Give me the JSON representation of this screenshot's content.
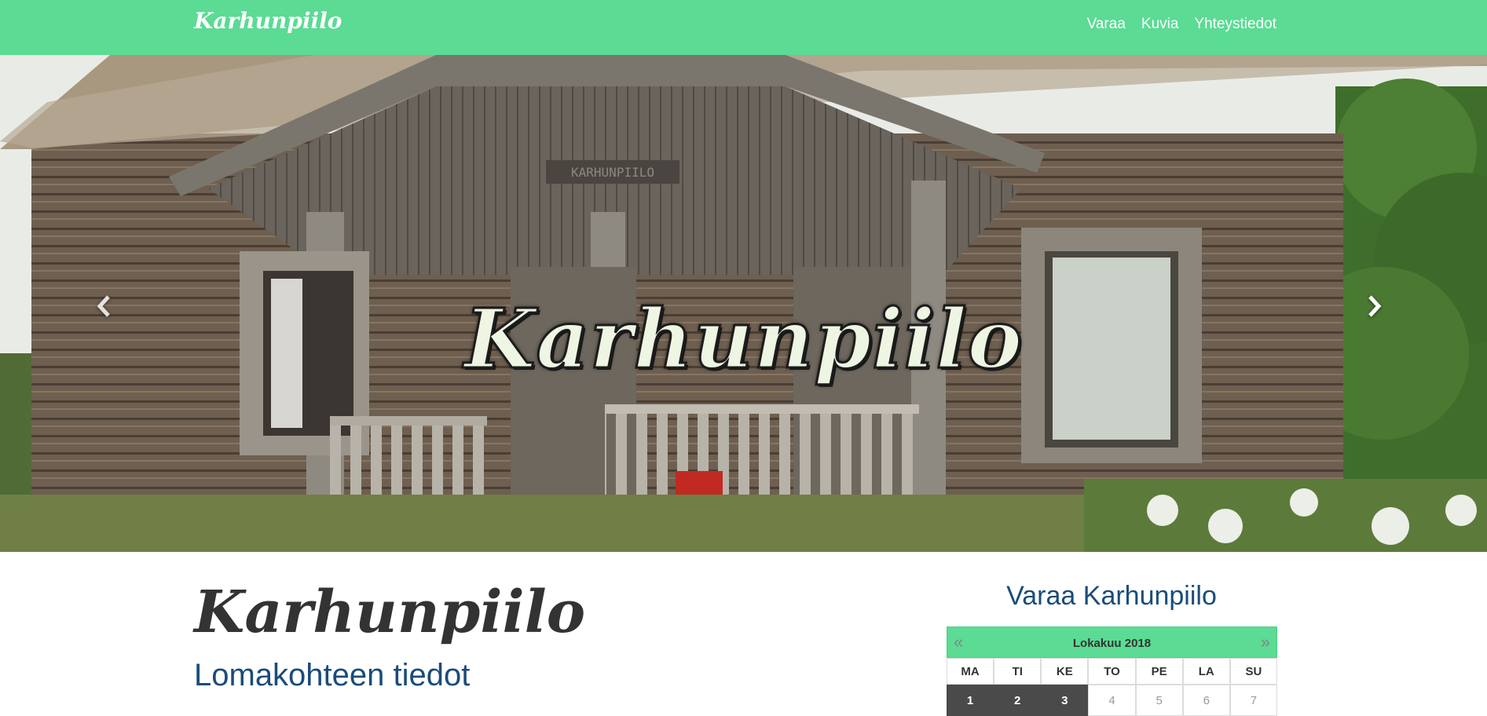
{
  "navbar": {
    "brand": "Karhunpiilo",
    "links": [
      "Varaa",
      "Kuvia",
      "Yhteystiedot"
    ]
  },
  "hero": {
    "title": "Karhunpiilo",
    "sign_text": "KARHUNPIILO"
  },
  "content": {
    "title": "Karhunpiilo",
    "subtitle": "Lomakohteen tiedot"
  },
  "booking": {
    "title": "Varaa Karhunpiilo",
    "calendar": {
      "prev": "«",
      "next": "»",
      "month": "Lokakuu 2018",
      "weekdays": [
        "MA",
        "TI",
        "KE",
        "TO",
        "PE",
        "LA",
        "SU"
      ],
      "dates": [
        "1",
        "2",
        "3",
        "4",
        "5",
        "6",
        "7"
      ],
      "booked": [
        "1",
        "2",
        "3"
      ]
    }
  },
  "colors": {
    "navbar": "#5bdb93",
    "heading_blue": "#1a4c7a",
    "booked_day": "#4a4a4a"
  },
  "icons": {
    "carousel_prev": "chevron-left-icon",
    "carousel_next": "chevron-right-icon"
  }
}
